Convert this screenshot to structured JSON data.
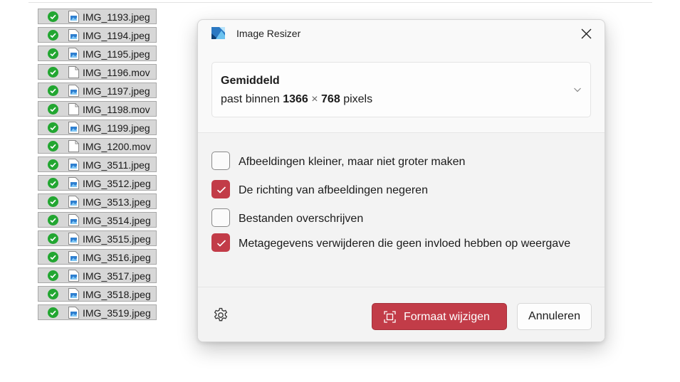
{
  "files": [
    {
      "name": "IMG_1193.jpeg",
      "type": "image"
    },
    {
      "name": "IMG_1194.jpeg",
      "type": "image"
    },
    {
      "name": "IMG_1195.jpeg",
      "type": "image"
    },
    {
      "name": "IMG_1196.mov",
      "type": "video"
    },
    {
      "name": "IMG_1197.jpeg",
      "type": "image"
    },
    {
      "name": "IMG_1198.mov",
      "type": "video"
    },
    {
      "name": "IMG_1199.jpeg",
      "type": "image"
    },
    {
      "name": "IMG_1200.mov",
      "type": "video"
    },
    {
      "name": "IMG_3511.jpeg",
      "type": "image"
    },
    {
      "name": "IMG_3512.jpeg",
      "type": "image"
    },
    {
      "name": "IMG_3513.jpeg",
      "type": "image"
    },
    {
      "name": "IMG_3514.jpeg",
      "type": "image"
    },
    {
      "name": "IMG_3515.jpeg",
      "type": "image"
    },
    {
      "name": "IMG_3516.jpeg",
      "type": "image"
    },
    {
      "name": "IMG_3517.jpeg",
      "type": "image"
    },
    {
      "name": "IMG_3518.jpeg",
      "type": "image"
    },
    {
      "name": "IMG_3519.jpeg",
      "type": "image"
    }
  ],
  "dialog": {
    "title": "Image Resizer",
    "size": {
      "name": "Gemiddeld",
      "prefix": "past binnen",
      "width": "1366",
      "times": "×",
      "height": "768",
      "unit": "pixels"
    },
    "options": [
      {
        "label": "Afbeeldingen kleiner, maar niet groter maken",
        "checked": false
      },
      {
        "label": "De richting van afbeeldingen negeren",
        "checked": true
      },
      {
        "label": "Bestanden overschrijven",
        "checked": false
      },
      {
        "label": "Metagegevens verwijderen die geen invloed hebben op weergave",
        "checked": true
      }
    ],
    "primary_button": "Formaat wijzigen",
    "cancel_button": "Annuleren"
  },
  "icons": {
    "status": "check-circle-icon",
    "image_file": "image-file-icon",
    "video_file": "blank-file-icon",
    "app": "image-resizer-icon",
    "close": "close-icon",
    "chevron": "chevron-down-icon",
    "checkmark": "checkmark-icon",
    "settings": "gear-icon",
    "resize": "resize-icon"
  },
  "colors": {
    "accent": "#c23c48",
    "status_ok": "#22a631"
  }
}
